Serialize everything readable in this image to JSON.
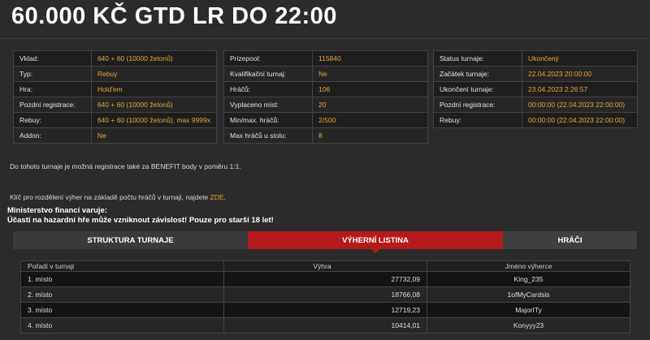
{
  "title": "60.000 KČ GTD LR DO 22:00",
  "info_left": [
    {
      "label": "Vklad:",
      "value": "640 + 60 (10000 žetonů)"
    },
    {
      "label": "Typ:",
      "value": "Rebuy"
    },
    {
      "label": "Hra:",
      "value": "Hold'em"
    },
    {
      "label": "Pozdní registrace:",
      "value": "640 + 60 (10000 žetonů)"
    },
    {
      "label": "Rebuy:",
      "value": "640 + 60 (10000 žetonů), max 9999x"
    },
    {
      "label": "Addon:",
      "value": "Ne"
    }
  ],
  "info_mid": [
    {
      "label": "Prizepool:",
      "value": "115840"
    },
    {
      "label": "Kvalifikační turnaj:",
      "value": "Ne"
    },
    {
      "label": "Hráčů:",
      "value": "106"
    },
    {
      "label": "Vyplaceno míst:",
      "value": "20"
    },
    {
      "label": "Min/max. hráčů:",
      "value": "2/500"
    },
    {
      "label": "Max hráčů u stolu:",
      "value": "8"
    }
  ],
  "info_right": [
    {
      "label": "Status turnaje:",
      "value": "Ukončený"
    },
    {
      "label": "Začátek turnaje:",
      "value": "22.04.2023 20:00:00"
    },
    {
      "label": "Ukončení turnaje:",
      "value": "23.04.2023 2:26:57"
    },
    {
      "label": "Pozdní registrace:",
      "value": "00:00:00 (22.04.2023 22:00:00)"
    },
    {
      "label": "Rebuy:",
      "value": "00:00:00 (22.04.2023 22:00:00)"
    }
  ],
  "notes": {
    "benefit": "Do tohoto turnaje je možná registrace také za BENEFIT body v poměru 1:1.",
    "key_text": "Klíč pro rozdělení výher na základě počtu hráčů v turnaji, najdete ",
    "key_link": "ZDE",
    "key_end": "."
  },
  "warning": {
    "line1": "Ministerstvo financí varuje:",
    "line2": "Účastí na hazardní hře může vzniknout závislost! Pouze pro starší 18 let!"
  },
  "tabs": {
    "structure": "STRUKTURA TURNAJE",
    "winners": "VÝHERNÍ LISTINA",
    "players": "HRÁČI"
  },
  "results": {
    "headers": [
      "Pořadí v turnaji",
      "Výhra",
      "Jméno výherce"
    ],
    "rows": [
      {
        "place": "1. místo",
        "prize": "27732,09",
        "name": "King_235"
      },
      {
        "place": "2. místo",
        "prize": "18766,08",
        "name": "1ofMyCardsis"
      },
      {
        "place": "3. místo",
        "prize": "12719,23",
        "name": "MajorITy"
      },
      {
        "place": "4. místo",
        "prize": "10414,01",
        "name": "Konyyy23"
      }
    ]
  },
  "colors": {
    "accent": "#e5a637",
    "active_tab": "#b41a1a",
    "background": "#2b2b2b"
  }
}
